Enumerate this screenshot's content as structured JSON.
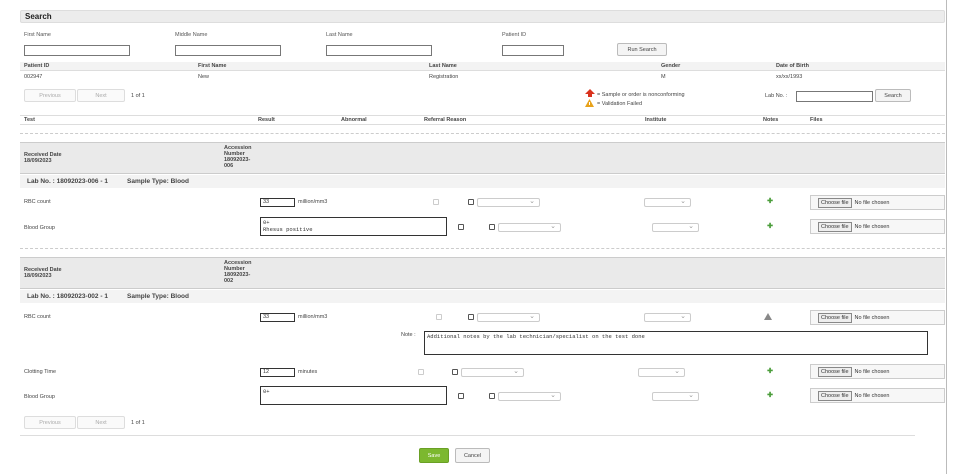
{
  "search": {
    "title": "Search",
    "first_name_label": "First Name",
    "middle_name_label": "Middle Name",
    "last_name_label": "Last Name",
    "patient_id_label": "Patient ID",
    "run_search": "Run Search"
  },
  "patients": {
    "headers": [
      "Patient ID",
      "First Name",
      "Last Name",
      "Gender",
      "Date of Birth"
    ],
    "row": [
      "002947",
      "New",
      "Registration",
      "M",
      "xx/xx/1993"
    ]
  },
  "pager": {
    "previous": "Previous",
    "next": "Next",
    "info": "1 of 1"
  },
  "legend": {
    "nonconforming": "= Sample or order is nonconforming",
    "validation_failed": "= Validation Failed"
  },
  "lab_search": {
    "label": "Lab No. :",
    "button": "Search"
  },
  "results_headers": [
    "Test",
    "Result",
    "Abnormal",
    "Referral Reason",
    "Institute",
    "Notes",
    "Files"
  ],
  "groups": [
    {
      "received_label": "Received Date",
      "received_date": "18/09/2023",
      "accession_label": "Accession\nNumber",
      "accession_number": "18092023-\n006",
      "lab_no": "Lab No. :  18092023-006 - 1",
      "sample_type": "Sample Type: Blood",
      "tests": [
        {
          "name": "RBC count",
          "value": "33",
          "unit": "million/mm3"
        },
        {
          "name": "Blood Group",
          "value": "0+\nRhesus positive",
          "unit": ""
        }
      ]
    },
    {
      "received_label": "Received Date",
      "received_date": "18/09/2023",
      "accession_label": "Accession\nNumber",
      "accession_number": "18092023-\n002",
      "lab_no": "Lab No. :  18092023-002 - 1",
      "sample_type": "Sample Type: Blood",
      "tests": [
        {
          "name": "RBC count",
          "value": "33",
          "unit": "million/mm3"
        },
        {
          "name": "Clotting Time",
          "value": "12",
          "unit": "minutes"
        },
        {
          "name": "Blood Group",
          "value": "0+",
          "unit": ""
        }
      ],
      "note_label": "Note :",
      "note_text": "Additional notes by the lab technician/specialist on the test done"
    }
  ],
  "file": {
    "button": "Choose file",
    "status": "No file chosen"
  },
  "actions": {
    "save": "Save",
    "cancel": "Cancel"
  },
  "colors": {
    "save_green": "#7cb82f",
    "header_gray": "#ececec",
    "warning_orange": "#e8a21b",
    "nonconforming_red": "#d9321d"
  }
}
